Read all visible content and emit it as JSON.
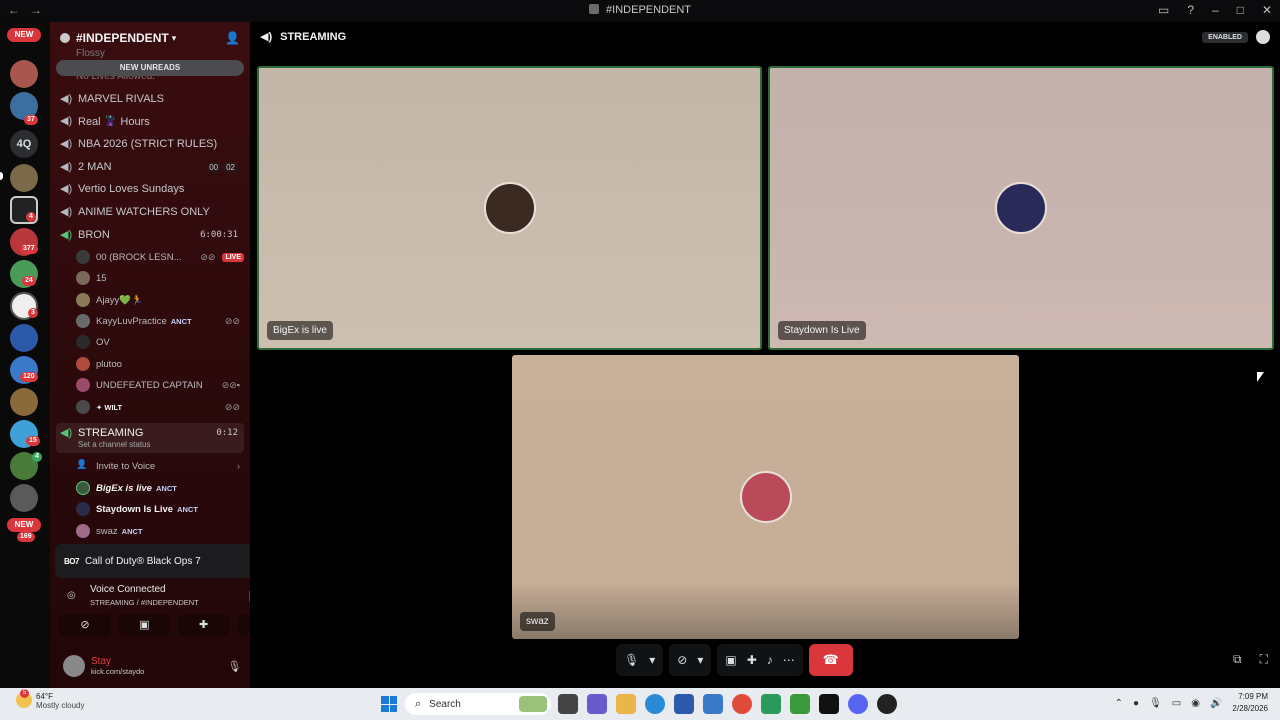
{
  "window": {
    "title": "#INDEPENDENT"
  },
  "server": {
    "name": "#INDEPENDENT",
    "new_unreads": "NEW UNREADS"
  },
  "rail": {
    "new_top": "NEW",
    "quick": "4Q",
    "badges": [
      "37",
      "4",
      "377",
      "24",
      "3",
      "120",
      "15",
      "4"
    ],
    "new_bottom": "NEW",
    "bottom_badge": "169"
  },
  "faded_channels": [
    "Flossy",
    "No Lives Allowed."
  ],
  "channels": [
    {
      "name": "MARVEL RIVALS"
    },
    {
      "name": "Real 🦹 Hours"
    },
    {
      "name": "NBA 2026 (STRICT RULES)"
    },
    {
      "name": "2 MAN",
      "counts": [
        "00",
        "02"
      ]
    },
    {
      "name": "Vertio Loves Sundays"
    },
    {
      "name": "ANIME WATCHERS ONLY"
    },
    {
      "name": "BRON",
      "timer": "6:00:31"
    }
  ],
  "bron_members": [
    {
      "name": "00 (BROCK LESN...",
      "live": "LIVE"
    },
    {
      "name": "15"
    },
    {
      "name": "Ajayy💚🏃"
    },
    {
      "name": "KayyLuvPractice",
      "tag": "ANCT"
    },
    {
      "name": "OV"
    },
    {
      "name": "plutoo"
    },
    {
      "name": "UNDEFEATED CAPTAIN"
    },
    {
      "name": "✦ WILT"
    }
  ],
  "streaming": {
    "name": "STREAMING",
    "timer": "0:12",
    "status_prompt": "Set a channel status",
    "invite": "Invite to Voice",
    "members": [
      {
        "name": "BigEx is live",
        "tag": "ANCT"
      },
      {
        "name": "Staydown Is Live",
        "tag": "ANCT"
      },
      {
        "name": "swaz",
        "tag": "ANCT"
      }
    ]
  },
  "activity": {
    "logo": "BO7",
    "game": "Call of Duty® Black Ops 7"
  },
  "voice": {
    "status": "Voice Connected",
    "location": "STREAMING / #INDEPENDENT"
  },
  "user": {
    "name": "Stay",
    "sub": "kick.com/staydo"
  },
  "main": {
    "channel": "STREAMING",
    "enabled": "ENABLED",
    "tiles": [
      {
        "label": "BigEx is live"
      },
      {
        "label": "Staydown Is Live"
      },
      {
        "label": "swaz"
      }
    ]
  },
  "taskbar": {
    "weather_temp": "64°F",
    "weather_desc": "Mostly cloudy",
    "weather_badge": "5",
    "search_placeholder": "Search",
    "time": "7:09 PM",
    "date": "2/28/2026"
  },
  "colors": {
    "accent_red": "#da373c",
    "sidebar_bg": "#3a0d10",
    "speaking_border": "#2c6b3a",
    "live_green": "#58c47a"
  }
}
